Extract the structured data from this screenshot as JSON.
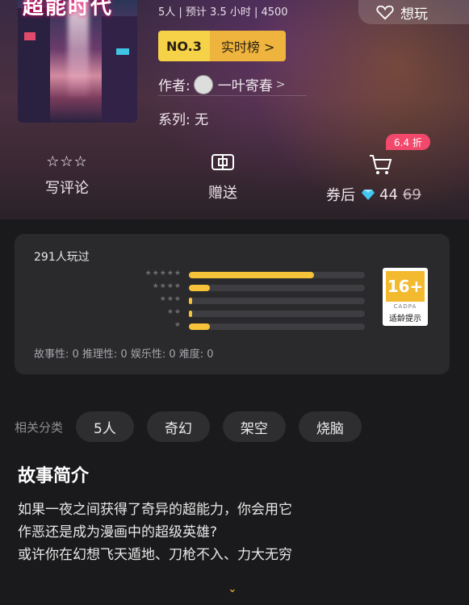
{
  "cover": {
    "title": "超能时代"
  },
  "header": {
    "meta": "5人 | 预计 3.5 小时 | 4500",
    "wish_label": "想玩"
  },
  "rank": {
    "no": "NO.3",
    "board": "实时榜 >"
  },
  "author": {
    "prefix": "作者:",
    "name": "一叶寄春",
    "chev": ">"
  },
  "series": {
    "text": "系列: 无"
  },
  "actions": {
    "review_label": "写评论",
    "review_stars": "☆☆☆",
    "gift_label": "赠送",
    "price_prefix": "券后",
    "price_now": "44",
    "price_old": "69",
    "discount": "6.4 折"
  },
  "ratings": {
    "played": "291人玩过",
    "rows": [
      {
        "stars": "★★★★★",
        "fraction": 0.71
      },
      {
        "stars": "★★★★",
        "fraction": 0.12
      },
      {
        "stars": "★★★",
        "fraction": 0.02
      },
      {
        "stars": "★★",
        "fraction": 0.02
      },
      {
        "stars": "★",
        "fraction": 0.12
      }
    ],
    "age_big": "16+",
    "age_org": "CADPA",
    "age_tip": "适龄提示",
    "scores": "故事性: 0  推理性: 0  娱乐性: 0  难度: 0"
  },
  "tags": {
    "label": "相关分类",
    "items": [
      "5人",
      "奇幻",
      "架空",
      "烧脑"
    ]
  },
  "intro": {
    "title": "故事简介",
    "lines": [
      "如果一夜之间获得了奇异的超能力，你会用它",
      "作恶还是成为漫画中的超级英雄?",
      "或许你在幻想飞天遁地、刀枪不入、力大无穷"
    ],
    "expand": "⌄"
  },
  "colors": {
    "accent": "#f6c23a",
    "discount": "#f2486c",
    "bg": "#1a1a1c"
  }
}
